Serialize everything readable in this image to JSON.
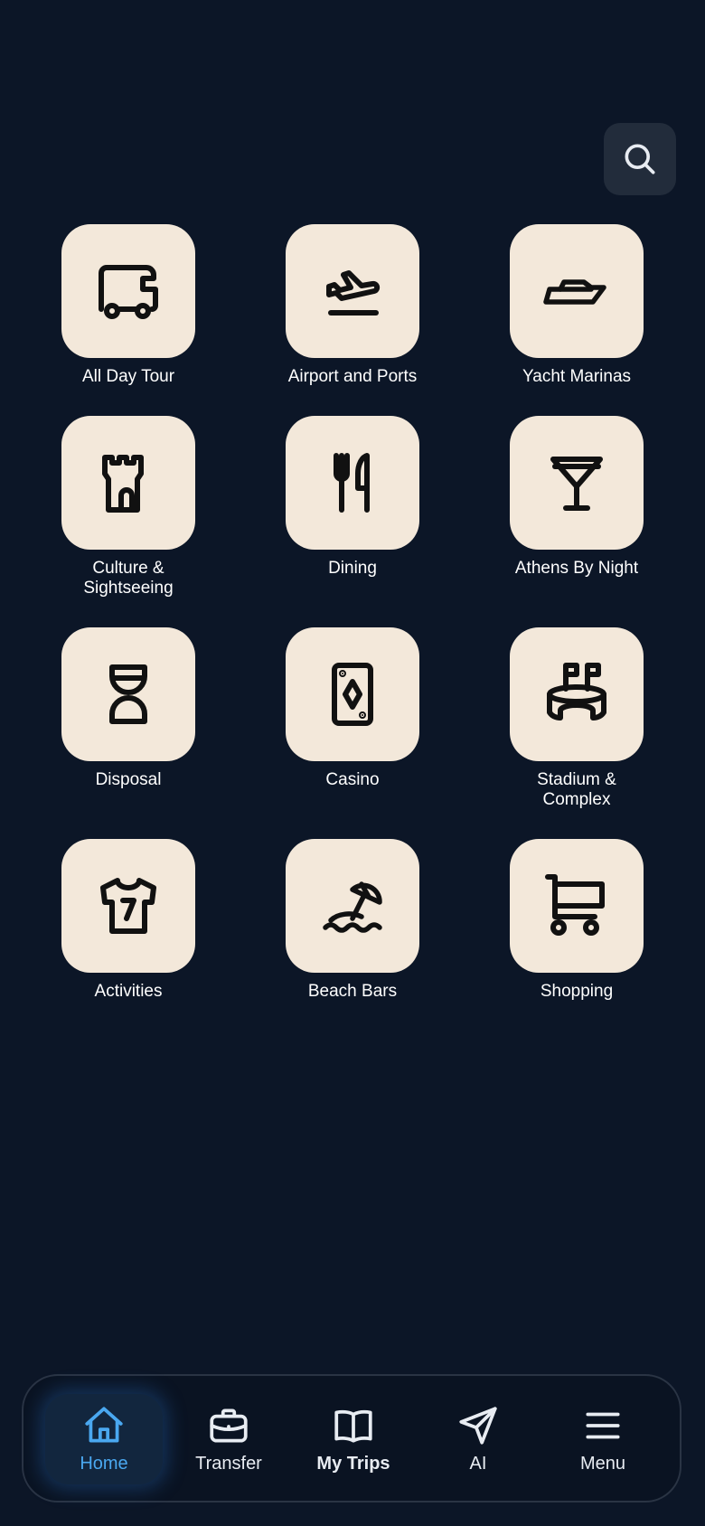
{
  "search": {
    "icon": "search-icon"
  },
  "tiles": [
    {
      "label": "All Day Tour",
      "icon": "camper-van-icon"
    },
    {
      "label": "Airport and Ports",
      "icon": "plane-departure-icon"
    },
    {
      "label": "Yacht Marinas",
      "icon": "yacht-icon"
    },
    {
      "label": "Culture &\nSightseeing",
      "icon": "castle-icon"
    },
    {
      "label": "Dining",
      "icon": "fork-knife-icon"
    },
    {
      "label": "Athens By Night",
      "icon": "cocktail-glass-icon"
    },
    {
      "label": "Disposal",
      "icon": "hourglass-icon"
    },
    {
      "label": "Casino",
      "icon": "playing-card-icon"
    },
    {
      "label": "Stadium &\nComplex",
      "icon": "stadium-icon"
    },
    {
      "label": "Activities",
      "icon": "jersey-icon"
    },
    {
      "label": "Beach Bars",
      "icon": "beach-umbrella-icon"
    },
    {
      "label": "Shopping",
      "icon": "shopping-cart-icon"
    }
  ],
  "nav": {
    "items": [
      {
        "label": "Home",
        "icon": "home-icon",
        "active": true
      },
      {
        "label": "Transfer",
        "icon": "briefcase-icon"
      },
      {
        "label": "My Trips",
        "icon": "book-icon"
      },
      {
        "label": "AI",
        "icon": "send-icon"
      },
      {
        "label": "Menu",
        "icon": "hamburger-menu-icon"
      }
    ]
  },
  "colors": {
    "background": "#0c1627",
    "tile": "#f3e8da",
    "accent": "#4aa8f0",
    "search_bg": "#222c3b"
  }
}
